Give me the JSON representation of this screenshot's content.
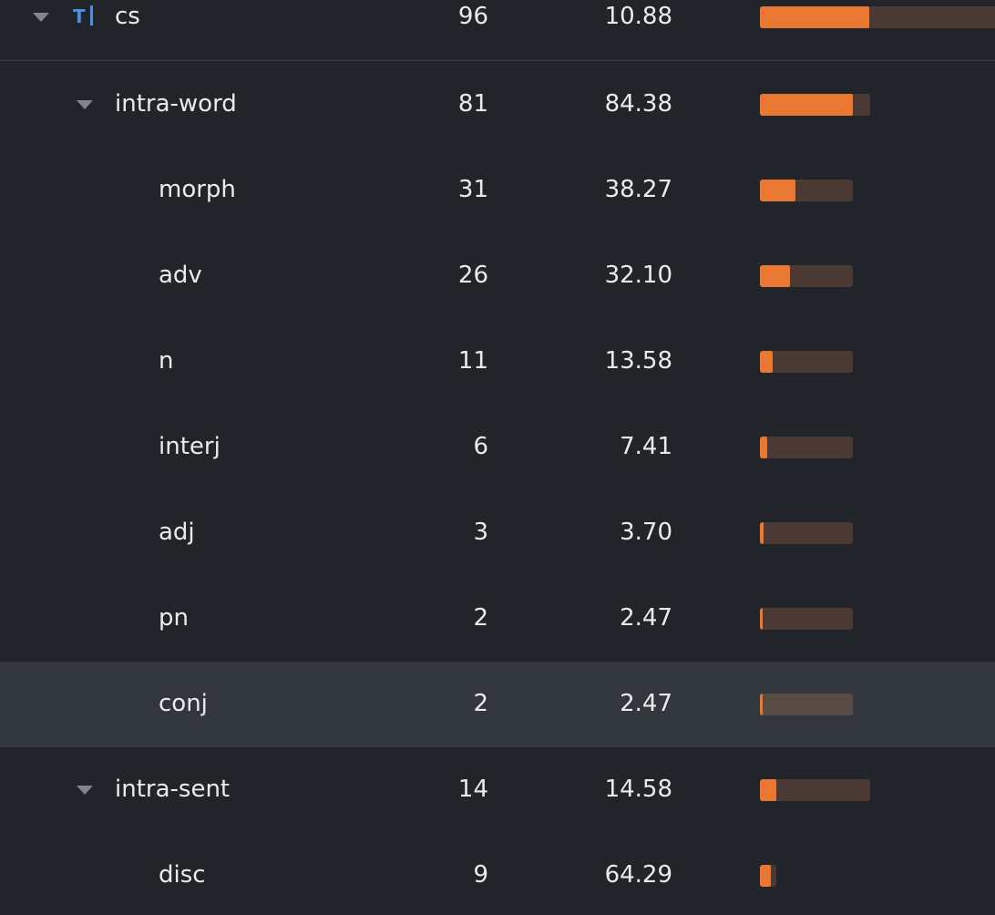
{
  "columns": [
    "name",
    "count",
    "percent",
    "bar"
  ],
  "rows": [
    {
      "label": "cs",
      "count": "96",
      "percent": "10.88",
      "level": 0,
      "expanded": true,
      "type_icon": "text-type-icon",
      "bar_fraction": 0.1088,
      "selected": false
    },
    {
      "label": "intra-word",
      "count": "81",
      "percent": "84.38",
      "level": 1,
      "expanded": true,
      "bar_fraction": 0.8438,
      "selected": false
    },
    {
      "label": "morph",
      "count": "31",
      "percent": "38.27",
      "level": 2,
      "bar_fraction": 0.3827,
      "selected": false
    },
    {
      "label": "adv",
      "count": "26",
      "percent": "32.10",
      "level": 2,
      "bar_fraction": 0.321,
      "selected": false
    },
    {
      "label": "n",
      "count": "11",
      "percent": "13.58",
      "level": 2,
      "bar_fraction": 0.1358,
      "selected": false
    },
    {
      "label": "interj",
      "count": "6",
      "percent": "7.41",
      "level": 2,
      "bar_fraction": 0.0741,
      "selected": false
    },
    {
      "label": "adj",
      "count": "3",
      "percent": "3.70",
      "level": 2,
      "bar_fraction": 0.037,
      "selected": false
    },
    {
      "label": "pn",
      "count": "2",
      "percent": "2.47",
      "level": 2,
      "bar_fraction": 0.0247,
      "selected": false
    },
    {
      "label": "conj",
      "count": "2",
      "percent": "2.47",
      "level": 2,
      "bar_fraction": 0.0247,
      "selected": true
    },
    {
      "label": "intra-sent",
      "count": "14",
      "percent": "14.58",
      "level": 1,
      "expanded": true,
      "bar_fraction": 0.1458,
      "selected": false
    },
    {
      "label": "disc",
      "count": "9",
      "percent": "64.29",
      "level": 2,
      "bar_fraction": 0.6429,
      "selected": false
    }
  ],
  "colors": {
    "background": "#212529",
    "selected_row": "#32373e",
    "bar_fill": "#ea7832",
    "bar_track": "#4a3a33",
    "type_icon": "#4c8fe0",
    "caret": "#7e8791"
  }
}
